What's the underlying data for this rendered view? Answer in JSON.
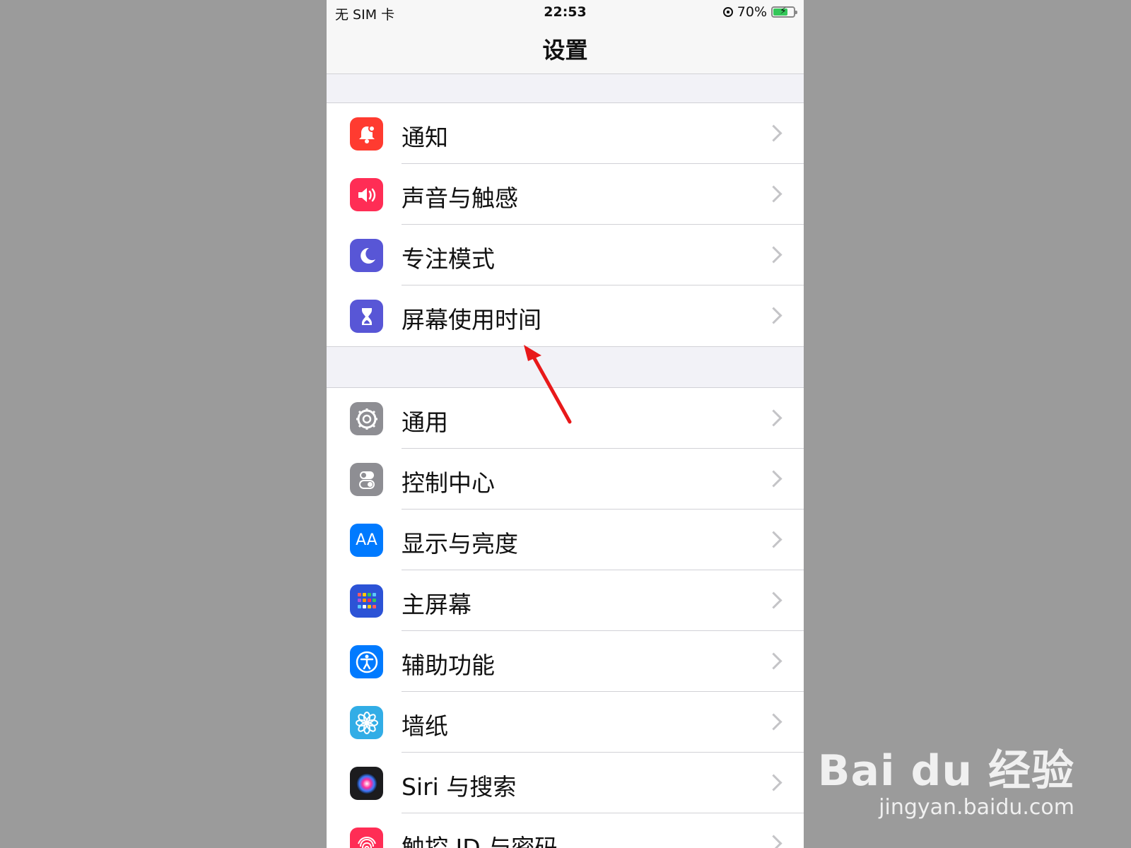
{
  "status_bar": {
    "carrier": "无 SIM 卡",
    "time": "22:53",
    "battery": "70%"
  },
  "nav": {
    "title": "设置"
  },
  "groups": [
    {
      "items": [
        {
          "label": "通知",
          "icon": "notification-bell-icon",
          "color": "#ff3b30"
        },
        {
          "label": "声音与触感",
          "icon": "speaker-icon",
          "color": "#ff2d55"
        },
        {
          "label": "专注模式",
          "icon": "moon-icon",
          "color": "#5856d6"
        },
        {
          "label": "屏幕使用时间",
          "icon": "hourglass-icon",
          "color": "#5856d6"
        }
      ]
    },
    {
      "items": [
        {
          "label": "通用",
          "icon": "gear-icon",
          "color": "#8e8e93"
        },
        {
          "label": "控制中心",
          "icon": "toggle-switches-icon",
          "color": "#8e8e93"
        },
        {
          "label": "显示与亮度",
          "icon": "text-size-icon",
          "color": "#007aff",
          "glyph": "AA"
        },
        {
          "label": "主屏幕",
          "icon": "home-grid-icon",
          "color": "#2c53d6"
        },
        {
          "label": "辅助功能",
          "icon": "accessibility-icon",
          "color": "#007aff"
        },
        {
          "label": "墙纸",
          "icon": "flower-icon",
          "color": "#32ade6"
        },
        {
          "label": "Siri 与搜索",
          "icon": "siri-icon",
          "color": "#1c1c1e"
        },
        {
          "label": "触控 ID 与密码",
          "icon": "fingerprint-icon",
          "color": "#ff2d55"
        }
      ]
    }
  ],
  "watermark": {
    "brand": "Bai du 经验",
    "url": "jingyan.baidu.com"
  },
  "annotation_color": "#e8191a"
}
